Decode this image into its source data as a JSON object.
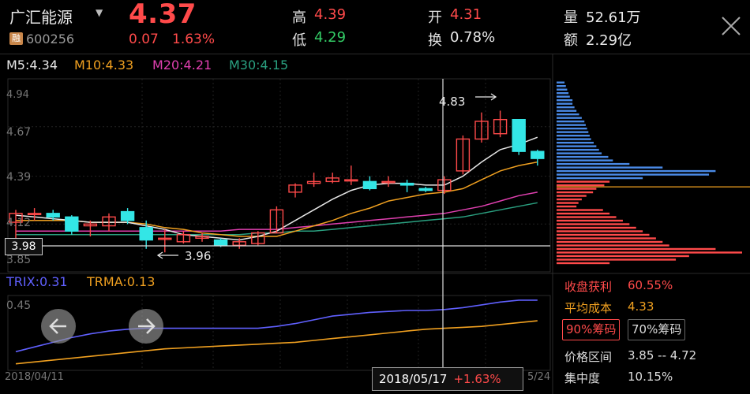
{
  "header": {
    "name": "广汇能源",
    "code_badge": "融",
    "code": "600256",
    "price": "4.37",
    "change": "0.07",
    "change_pct": "1.63%",
    "high_label": "高",
    "high": "4.39",
    "low_label": "低",
    "low": "4.29",
    "open_label": "开",
    "open": "4.31",
    "turnover_label": "换",
    "turnover": "0.78%",
    "volume_label": "量",
    "volume": "52.61万",
    "amount_label": "额",
    "amount": "2.29亿"
  },
  "ma_legend": {
    "ma5": "M5:4.34",
    "ma10": "M10:4.33",
    "ma20": "M20:4.21",
    "ma30": "M30:4.15"
  },
  "indicator_legend": {
    "trix": "TRIX:0.31",
    "trma": "TRMA:0.13"
  },
  "price_axis": {
    "t1": "4.94",
    "t2": "4.67",
    "t3": "4.39",
    "t4": "4.12",
    "t5": "3.85"
  },
  "indicator_axis": {
    "t1": "0.45"
  },
  "annotations": {
    "high": "4.83",
    "low": "3.96",
    "crosshair_price": "3.98"
  },
  "x_axis": {
    "start": "2018/04/11",
    "end": "5/24"
  },
  "crosshair": {
    "date": "2018/05/17",
    "pct": "+1.63%"
  },
  "chips": {
    "profit_label": "收盘获利",
    "profit": "60.55%",
    "avg_cost_label": "平均成本",
    "avg_cost": "4.33",
    "btn90": "90%筹码",
    "btn70": "70%筹码",
    "range_label": "价格区间",
    "range": "3.85 -- 4.72",
    "concentration_label": "集中度",
    "concentration": "10.15%"
  },
  "colors": {
    "up": "#ff4a4a",
    "down": "#33e6e6",
    "ma5": "#e8e8e8",
    "ma10": "#f0a020",
    "ma20": "#e040b0",
    "ma30": "#2aa080",
    "trix": "#6060ff",
    "trma": "#f0a020",
    "chip_profit": "#ff4a4a",
    "chip_loss": "#4a8ae6"
  },
  "chart_data": [
    {
      "type": "candlestick",
      "y_range": [
        3.85,
        4.94
      ],
      "candles": [
        {
          "o": 4.13,
          "h": 4.2,
          "l": 4.03,
          "c": 4.18
        },
        {
          "o": 4.18,
          "h": 4.21,
          "l": 4.14,
          "c": 4.18
        },
        {
          "o": 4.18,
          "h": 4.2,
          "l": 4.14,
          "c": 4.16
        },
        {
          "o": 4.16,
          "h": 4.17,
          "l": 4.06,
          "c": 4.08
        },
        {
          "o": 4.11,
          "h": 4.14,
          "l": 4.05,
          "c": 4.12
        },
        {
          "o": 4.11,
          "h": 4.18,
          "l": 4.08,
          "c": 4.16
        },
        {
          "o": 4.19,
          "h": 4.21,
          "l": 4.12,
          "c": 4.14
        },
        {
          "o": 4.1,
          "h": 4.14,
          "l": 3.98,
          "c": 4.03
        },
        {
          "o": 4.04,
          "h": 4.09,
          "l": 3.96,
          "c": 4.04
        },
        {
          "o": 4.02,
          "h": 4.08,
          "l": 4.01,
          "c": 4.06
        },
        {
          "o": 4.04,
          "h": 4.07,
          "l": 4.02,
          "c": 4.05
        },
        {
          "o": 4.03,
          "h": 4.04,
          "l": 3.99,
          "c": 4.0
        },
        {
          "o": 4.0,
          "h": 4.04,
          "l": 3.98,
          "c": 4.02
        },
        {
          "o": 4.01,
          "h": 4.08,
          "l": 4.0,
          "c": 4.07
        },
        {
          "o": 4.07,
          "h": 4.22,
          "l": 4.07,
          "c": 4.2
        },
        {
          "o": 4.3,
          "h": 4.35,
          "l": 4.27,
          "c": 4.34
        },
        {
          "o": 4.35,
          "h": 4.41,
          "l": 4.33,
          "c": 4.36
        },
        {
          "o": 4.36,
          "h": 4.41,
          "l": 4.35,
          "c": 4.38
        },
        {
          "o": 4.37,
          "h": 4.45,
          "l": 4.34,
          "c": 4.37
        },
        {
          "o": 4.36,
          "h": 4.39,
          "l": 4.31,
          "c": 4.32
        },
        {
          "o": 4.36,
          "h": 4.39,
          "l": 4.33,
          "c": 4.36
        },
        {
          "o": 4.35,
          "h": 4.37,
          "l": 4.3,
          "c": 4.34
        },
        {
          "o": 4.32,
          "h": 4.33,
          "l": 4.3,
          "c": 4.31
        },
        {
          "o": 4.31,
          "h": 4.39,
          "l": 4.29,
          "c": 4.37
        },
        {
          "o": 4.42,
          "h": 4.62,
          "l": 4.4,
          "c": 4.6
        },
        {
          "o": 4.6,
          "h": 4.75,
          "l": 4.58,
          "c": 4.7
        },
        {
          "o": 4.63,
          "h": 4.76,
          "l": 4.61,
          "c": 4.71
        },
        {
          "o": 4.71,
          "h": 4.71,
          "l": 4.51,
          "c": 4.53
        },
        {
          "o": 4.53,
          "h": 4.54,
          "l": 4.45,
          "c": 4.49
        }
      ],
      "ma5": [
        4.17,
        4.16,
        4.15,
        4.14,
        4.13,
        4.13,
        4.13,
        4.11,
        4.09,
        4.06,
        4.05,
        4.04,
        4.03,
        4.05,
        4.08,
        4.14,
        4.2,
        4.26,
        4.31,
        4.34,
        4.35,
        4.35,
        4.34,
        4.34,
        4.39,
        4.47,
        4.54,
        4.57,
        4.61
      ],
      "ma10": [
        4.14,
        4.14,
        4.14,
        4.14,
        4.13,
        4.13,
        4.13,
        4.12,
        4.1,
        4.09,
        4.07,
        4.06,
        4.05,
        4.05,
        4.05,
        4.08,
        4.11,
        4.14,
        4.18,
        4.21,
        4.25,
        4.27,
        4.29,
        4.3,
        4.32,
        4.37,
        4.42,
        4.45,
        4.47
      ],
      "ma20": [
        4.08,
        4.08,
        4.08,
        4.08,
        4.08,
        4.08,
        4.08,
        4.08,
        4.08,
        4.08,
        4.08,
        4.08,
        4.09,
        4.09,
        4.09,
        4.1,
        4.11,
        4.12,
        4.13,
        4.14,
        4.15,
        4.16,
        4.17,
        4.18,
        4.2,
        4.22,
        4.25,
        4.28,
        4.3
      ],
      "ma30": [
        4.06,
        4.06,
        4.06,
        4.06,
        4.06,
        4.06,
        4.06,
        4.06,
        4.06,
        4.06,
        4.06,
        4.06,
        4.06,
        4.07,
        4.07,
        4.08,
        4.08,
        4.09,
        4.1,
        4.11,
        4.12,
        4.13,
        4.14,
        4.15,
        4.16,
        4.18,
        4.2,
        4.22,
        4.24
      ]
    },
    {
      "type": "line",
      "y_range": [
        -0.25,
        0.55
      ],
      "series": [
        {
          "name": "TRIX",
          "values": [
            -0.05,
            0.0,
            0.05,
            0.1,
            0.14,
            0.17,
            0.19,
            0.2,
            0.2,
            0.2,
            0.2,
            0.2,
            0.2,
            0.2,
            0.22,
            0.25,
            0.29,
            0.33,
            0.35,
            0.37,
            0.38,
            0.39,
            0.39,
            0.4,
            0.42,
            0.45,
            0.48,
            0.5,
            0.5
          ]
        },
        {
          "name": "TRMA",
          "values": [
            -0.18,
            -0.16,
            -0.14,
            -0.12,
            -0.1,
            -0.08,
            -0.06,
            -0.04,
            -0.02,
            -0.01,
            0.0,
            0.01,
            0.02,
            0.03,
            0.04,
            0.05,
            0.07,
            0.09,
            0.11,
            0.13,
            0.15,
            0.17,
            0.19,
            0.2,
            0.21,
            0.22,
            0.24,
            0.26,
            0.28
          ]
        }
      ]
    },
    {
      "type": "bar",
      "orientation": "horizontal",
      "y_range": [
        3.85,
        4.94
      ],
      "profit_price_max": 4.37,
      "prices": [
        4.92,
        4.9,
        4.88,
        4.86,
        4.84,
        4.82,
        4.8,
        4.78,
        4.76,
        4.74,
        4.72,
        4.7,
        4.68,
        4.66,
        4.64,
        4.62,
        4.6,
        4.58,
        4.56,
        4.54,
        4.52,
        4.5,
        4.48,
        4.46,
        4.44,
        4.42,
        4.4,
        4.38,
        4.36,
        4.34,
        4.32,
        4.3,
        4.28,
        4.26,
        4.24,
        4.22,
        4.2,
        4.18,
        4.16,
        4.14,
        4.12,
        4.1,
        4.08,
        4.06,
        4.04,
        4.02,
        4.0,
        3.98,
        3.96,
        3.94,
        3.92,
        3.9
      ],
      "values": [
        12,
        14,
        16,
        18,
        20,
        24,
        24,
        27,
        30,
        34,
        38,
        42,
        44,
        46,
        48,
        50,
        52,
        56,
        60,
        64,
        68,
        78,
        85,
        110,
        160,
        240,
        230,
        130,
        80,
        72,
        60,
        55,
        45,
        38,
        33,
        30,
        70,
        80,
        90,
        100,
        110,
        120,
        130,
        140,
        150,
        160,
        170,
        240,
        280,
        200,
        180,
        80
      ]
    }
  ]
}
